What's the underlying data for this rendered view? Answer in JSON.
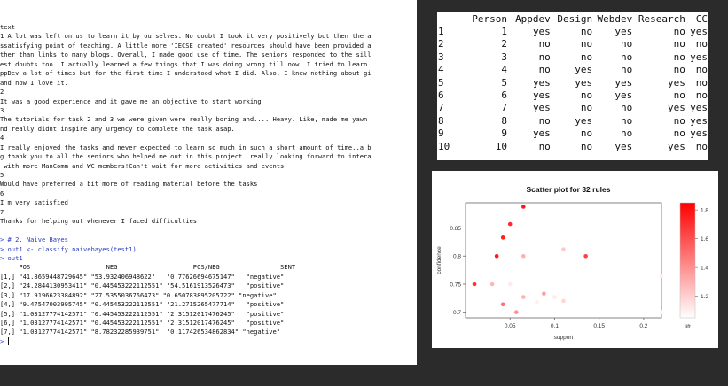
{
  "console": {
    "lines": [
      {
        "text": "text",
        "kind": "out"
      },
      {
        "text": "1 A lot was left on us to learn it by ourselves. No doubt I took it very positively but then the a",
        "kind": "out"
      },
      {
        "text": "ssatisfying point of teaching. A little more 'IECSE created' resources should have been provided a",
        "kind": "out"
      },
      {
        "text": "ther than links to many blogs. Overall, I made good use of time. The seniors responded to the sill",
        "kind": "out"
      },
      {
        "text": "est doubts too. I actually learned a few things that I was doing wrong till now. I tried to learn",
        "kind": "out"
      },
      {
        "text": "ppDev a lot of times but for the first time I understood what I did. Also, I knew nothing about gi",
        "kind": "out"
      },
      {
        "text": "and now I love it.",
        "kind": "out"
      },
      {
        "text": "2",
        "kind": "out"
      },
      {
        "text": "It was a good experience and it gave me an objective to start working",
        "kind": "out"
      },
      {
        "text": "3",
        "kind": "out"
      },
      {
        "text": "The tutorials for task 2 and 3 we were given were really boring and.... Heavy. Like, made me yawn",
        "kind": "out"
      },
      {
        "text": "nd really didnt inspire any urgency to complete the task asap.",
        "kind": "out"
      },
      {
        "text": "4",
        "kind": "out"
      },
      {
        "text": "I really enjoyed the tasks and never expected to learn so much in such a short amount of time..a b",
        "kind": "out"
      },
      {
        "text": "g thank you to all the seniors who helped me out in this project..really looking forward to intera",
        "kind": "out"
      },
      {
        "text": " with more ManComm and WC members!Can't wait for more activities and events!",
        "kind": "out"
      },
      {
        "text": "5",
        "kind": "out"
      },
      {
        "text": "Would have preferred a bit more of reading material before the tasks",
        "kind": "out"
      },
      {
        "text": "6",
        "kind": "out"
      },
      {
        "text": "I m very satisfied",
        "kind": "out"
      },
      {
        "text": "7",
        "kind": "out"
      },
      {
        "text": "Thanks for helping out whenever I faced difficulties",
        "kind": "out"
      },
      {
        "text": "",
        "kind": "out"
      },
      {
        "text": "> # 2. Naive Bayes",
        "kind": "prompt"
      },
      {
        "text": "> out1 <- classify.naivebayes(test1)",
        "kind": "prompt"
      },
      {
        "text": "> out1",
        "kind": "prompt"
      },
      {
        "text": "     POS                    NEG                    POS/NEG                SENT",
        "kind": "out"
      },
      {
        "text": "[1,] \"41.8659448729645\" \"53.932406948622\"   \"0.77626694675147\"   \"negative\"",
        "kind": "out"
      },
      {
        "text": "[2,] \"24.2844130953411\" \"0.445453222112551\" \"54.5161913526473\"   \"positive\"",
        "kind": "out"
      },
      {
        "text": "[3,] \"17.9196623384892\" \"27.5355036756473\" \"0.650783895205722\" \"negative\"",
        "kind": "out"
      },
      {
        "text": "[4,] \"9.47547003995745\" \"0.445453222112551\" \"21.2715265477714\"   \"positive\"",
        "kind": "out"
      },
      {
        "text": "[5,] \"1.03127774142571\" \"0.445453222112551\" \"2.31512017476245\"   \"positive\"",
        "kind": "out"
      },
      {
        "text": "[6,] \"1.03127774142571\" \"0.445453222112551\" \"2.31512017476245\"   \"positive\"",
        "kind": "out"
      },
      {
        "text": "[7,] \"1.03127774142571\" \"8.78232285939751\"  \"0.117426534862834\" \"negative\"",
        "kind": "out"
      },
      {
        "text": "> ",
        "kind": "prompt",
        "cursor": true
      }
    ]
  },
  "dataframe": {
    "columns": [
      "Person",
      "Appdev",
      "Design",
      "Webdev",
      "Research",
      "CC"
    ],
    "rows": [
      {
        "name": "1",
        "Person": "1",
        "Appdev": "yes",
        "Design": "no",
        "Webdev": "yes",
        "Research": "no",
        "CC": "yes"
      },
      {
        "name": "2",
        "Person": "2",
        "Appdev": "no",
        "Design": "no",
        "Webdev": "no",
        "Research": "no",
        "CC": "no"
      },
      {
        "name": "3",
        "Person": "3",
        "Appdev": "no",
        "Design": "no",
        "Webdev": "no",
        "Research": "no",
        "CC": "yes"
      },
      {
        "name": "4",
        "Person": "4",
        "Appdev": "no",
        "Design": "yes",
        "Webdev": "no",
        "Research": "no",
        "CC": "no"
      },
      {
        "name": "5",
        "Person": "5",
        "Appdev": "yes",
        "Design": "yes",
        "Webdev": "yes",
        "Research": "yes",
        "CC": "no"
      },
      {
        "name": "6",
        "Person": "6",
        "Appdev": "yes",
        "Design": "no",
        "Webdev": "yes",
        "Research": "no",
        "CC": "no"
      },
      {
        "name": "7",
        "Person": "7",
        "Appdev": "yes",
        "Design": "no",
        "Webdev": "no",
        "Research": "yes",
        "CC": "yes"
      },
      {
        "name": "8",
        "Person": "8",
        "Appdev": "no",
        "Design": "yes",
        "Webdev": "no",
        "Research": "no",
        "CC": "yes"
      },
      {
        "name": "9",
        "Person": "9",
        "Appdev": "yes",
        "Design": "no",
        "Webdev": "no",
        "Research": "no",
        "CC": "yes"
      },
      {
        "name": "10",
        "Person": "10",
        "Appdev": "no",
        "Design": "no",
        "Webdev": "yes",
        "Research": "yes",
        "CC": "no"
      }
    ]
  },
  "chart_data": {
    "type": "scatter",
    "title": "Scatter plot for 32 rules",
    "xlabel": "support",
    "ylabel": "confidence",
    "xlim": [
      0,
      0.22
    ],
    "ylim": [
      0.69,
      0.895
    ],
    "xticks": [
      "0.05",
      "0.1",
      "0.15",
      "0.2"
    ],
    "yticks": [
      "0.7",
      "0.75",
      "0.8",
      "0.85"
    ],
    "legend": {
      "label": "lift",
      "ticks": [
        "1.2",
        "1.4",
        "1.6",
        "1.8"
      ],
      "range": [
        1.05,
        1.85
      ],
      "low_color": "#ffffff",
      "high_color": "#ff0000",
      "position": "right"
    },
    "points": [
      {
        "x": 0.065,
        "y": 0.888,
        "lift": 1.78
      },
      {
        "x": 0.05,
        "y": 0.857,
        "lift": 1.72
      },
      {
        "x": 0.042,
        "y": 0.833,
        "lift": 1.75
      },
      {
        "x": 0.035,
        "y": 0.8,
        "lift": 1.78
      },
      {
        "x": 0.065,
        "y": 0.8,
        "lift": 1.3
      },
      {
        "x": 0.11,
        "y": 0.812,
        "lift": 1.22
      },
      {
        "x": 0.135,
        "y": 0.8,
        "lift": 1.65
      },
      {
        "x": 0.01,
        "y": 0.75,
        "lift": 1.7
      },
      {
        "x": 0.03,
        "y": 0.75,
        "lift": 1.28
      },
      {
        "x": 0.05,
        "y": 0.75,
        "lift": 1.12
      },
      {
        "x": 0.042,
        "y": 0.714,
        "lift": 1.5
      },
      {
        "x": 0.065,
        "y": 0.727,
        "lift": 1.3
      },
      {
        "x": 0.057,
        "y": 0.7,
        "lift": 1.4
      },
      {
        "x": 0.088,
        "y": 0.733,
        "lift": 1.35
      },
      {
        "x": 0.1,
        "y": 0.727,
        "lift": 1.12
      },
      {
        "x": 0.08,
        "y": 0.718,
        "lift": 1.1
      },
      {
        "x": 0.11,
        "y": 0.72,
        "lift": 1.18
      },
      {
        "x": 0.22,
        "y": 0.765,
        "lift": 1.1
      },
      {
        "x": 0.22,
        "y": 0.7,
        "lift": 1.08
      }
    ]
  }
}
